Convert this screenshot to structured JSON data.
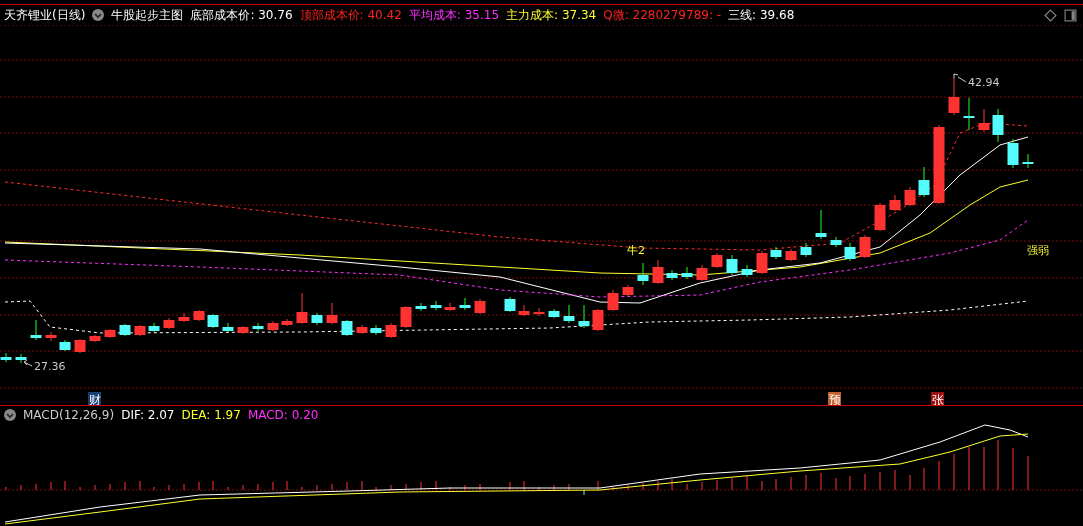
{
  "header": {
    "stock": "天齐锂业(日线)",
    "template": "牛股起步主图",
    "indicators": [
      {
        "text": "底部成本价: 30.76",
        "kind": "bottom"
      },
      {
        "text": "顶部成本价: 40.42",
        "kind": "top"
      },
      {
        "text": "平均成本: 35.15",
        "kind": "average"
      },
      {
        "text": "主力成本: 37.34",
        "kind": "main"
      },
      {
        "text": "Q微: 2280279789: -",
        "kind": "contact"
      },
      {
        "text": "三线: 39.68",
        "kind": "line"
      }
    ]
  },
  "chart_labels": {
    "high": "42.94",
    "low": "27.36",
    "signal": "牛2",
    "strength": "强弱"
  },
  "events": [
    {
      "label": "财",
      "color": "#1c3f73"
    },
    {
      "label": "预",
      "color": "#c0602a"
    },
    {
      "label": "张",
      "color": "#a01212"
    }
  ],
  "macd": {
    "name": "MACD(12,26,9)",
    "indicators": [
      {
        "text": "DIF: 2.07",
        "kind": "dif"
      },
      {
        "text": "DEA: 1.97",
        "kind": "dea"
      },
      {
        "text": "MACD: 0.20",
        "kind": "macd"
      }
    ]
  }
}
